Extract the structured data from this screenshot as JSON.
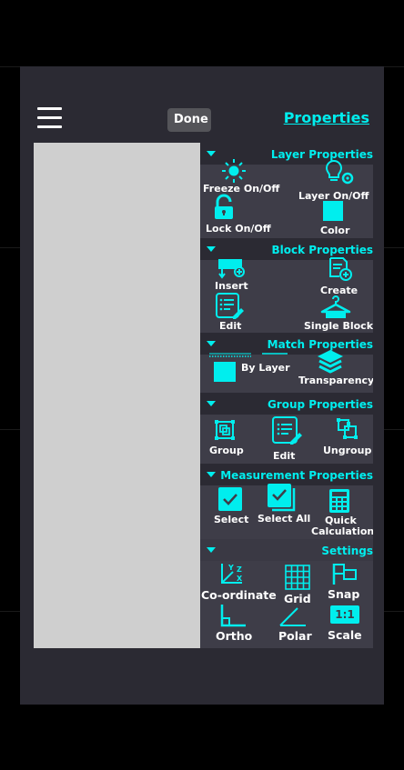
{
  "header": {
    "done_label": "Done",
    "title": "Properties"
  },
  "panel": {
    "layer": {
      "title": "Layer Properties",
      "freeze": "Freeze On/Off",
      "layer_onoff": "Layer On/Off",
      "lock": "Lock On/Off",
      "color": "Color"
    },
    "block": {
      "title": "Block Properties",
      "insert": "Insert",
      "create": "Create",
      "edit": "Edit",
      "single_block": "Single Block"
    },
    "match": {
      "title": "Match Properties",
      "by_layer": "By Layer",
      "transparency": "Transparency"
    },
    "group": {
      "title": "Group Properties",
      "group": "Group",
      "edit": "Edit",
      "ungroup": "Ungroup"
    },
    "measurement": {
      "title": "Measurement Properties",
      "select": "Select",
      "select_all": "Select All",
      "quick_calc_line1": "Quick",
      "quick_calc_line2": "Calculation"
    },
    "settings": {
      "title": "Settings",
      "coordinate": "Co-ordinate",
      "grid": "Grid",
      "snap": "Snap",
      "ortho": "Ortho",
      "polar": "Polar",
      "scale": "Scale",
      "scale_icon_text": "1:1"
    }
  },
  "colors": {
    "accent": "#00EEEE",
    "screen_bg": "#2B2A33",
    "section_bg": "#3E3D48",
    "canvas": "#CFCFCF"
  }
}
